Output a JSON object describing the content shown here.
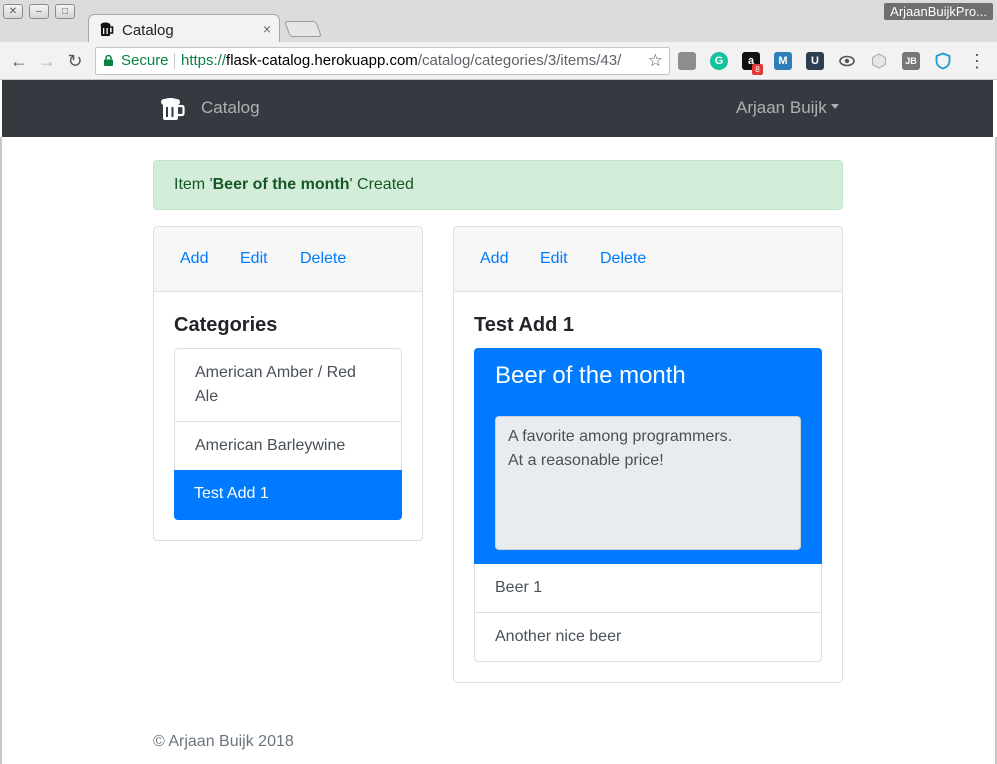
{
  "browser": {
    "tab_title": "Catalog",
    "tab_close": "×",
    "profile_name": "ArjaanBuijkPro...",
    "secure_label": "Secure",
    "url_scheme": "https://",
    "url_host": "flask-catalog.herokuapp.com",
    "url_path": "/catalog/categories/3/items/43/",
    "extensions": [
      {
        "name": "evernote-icon",
        "glyph": "",
        "color": "#8d8d8d"
      },
      {
        "name": "grammarly-icon",
        "glyph": "G",
        "color": "#15c39a"
      },
      {
        "name": "amazon-icon",
        "glyph": "a",
        "color": "#111111",
        "badge": "8"
      },
      {
        "name": "m-extension-icon",
        "glyph": "M",
        "color": "#2e7eb8"
      },
      {
        "name": "u-extension-icon",
        "glyph": "U",
        "color": "#2c3e50"
      },
      {
        "name": "eye-icon",
        "glyph": "",
        "color": "#555555"
      },
      {
        "name": "cube-icon",
        "glyph": "",
        "color": "#cccccc"
      },
      {
        "name": "jb-icon",
        "glyph": "JB",
        "color": "#777777"
      },
      {
        "name": "shield-icon",
        "glyph": "",
        "color": "#1e9bd7"
      }
    ]
  },
  "navbar": {
    "brand": "Catalog",
    "user": "Arjaan Buijk"
  },
  "alert": {
    "prefix": "Item '",
    "item": "Beer of the month",
    "suffix": "' Created"
  },
  "categories_card": {
    "actions": {
      "add": "Add",
      "edit": "Edit",
      "delete": "Delete"
    },
    "title": "Categories",
    "items": [
      {
        "line1": "American Amber / Red",
        "line2": "Ale"
      },
      {
        "label": "American Barleywine"
      },
      {
        "label": "Test Add 1",
        "active": true
      }
    ]
  },
  "items_card": {
    "actions": {
      "add": "Add",
      "edit": "Edit",
      "delete": "Delete"
    },
    "title": "Test Add 1",
    "active_item": {
      "name": "Beer of the month",
      "description_line1": "A favorite among programmers.",
      "description_line2": "At a reasonable price!"
    },
    "items": [
      {
        "label": "Beer 1"
      },
      {
        "label": "Another nice beer"
      }
    ]
  },
  "footer": "© Arjaan Buijk 2018",
  "colors": {
    "primary": "#007bff",
    "navbar": "#343a40",
    "alert_bg": "#d4edda",
    "alert_text": "#155724"
  }
}
